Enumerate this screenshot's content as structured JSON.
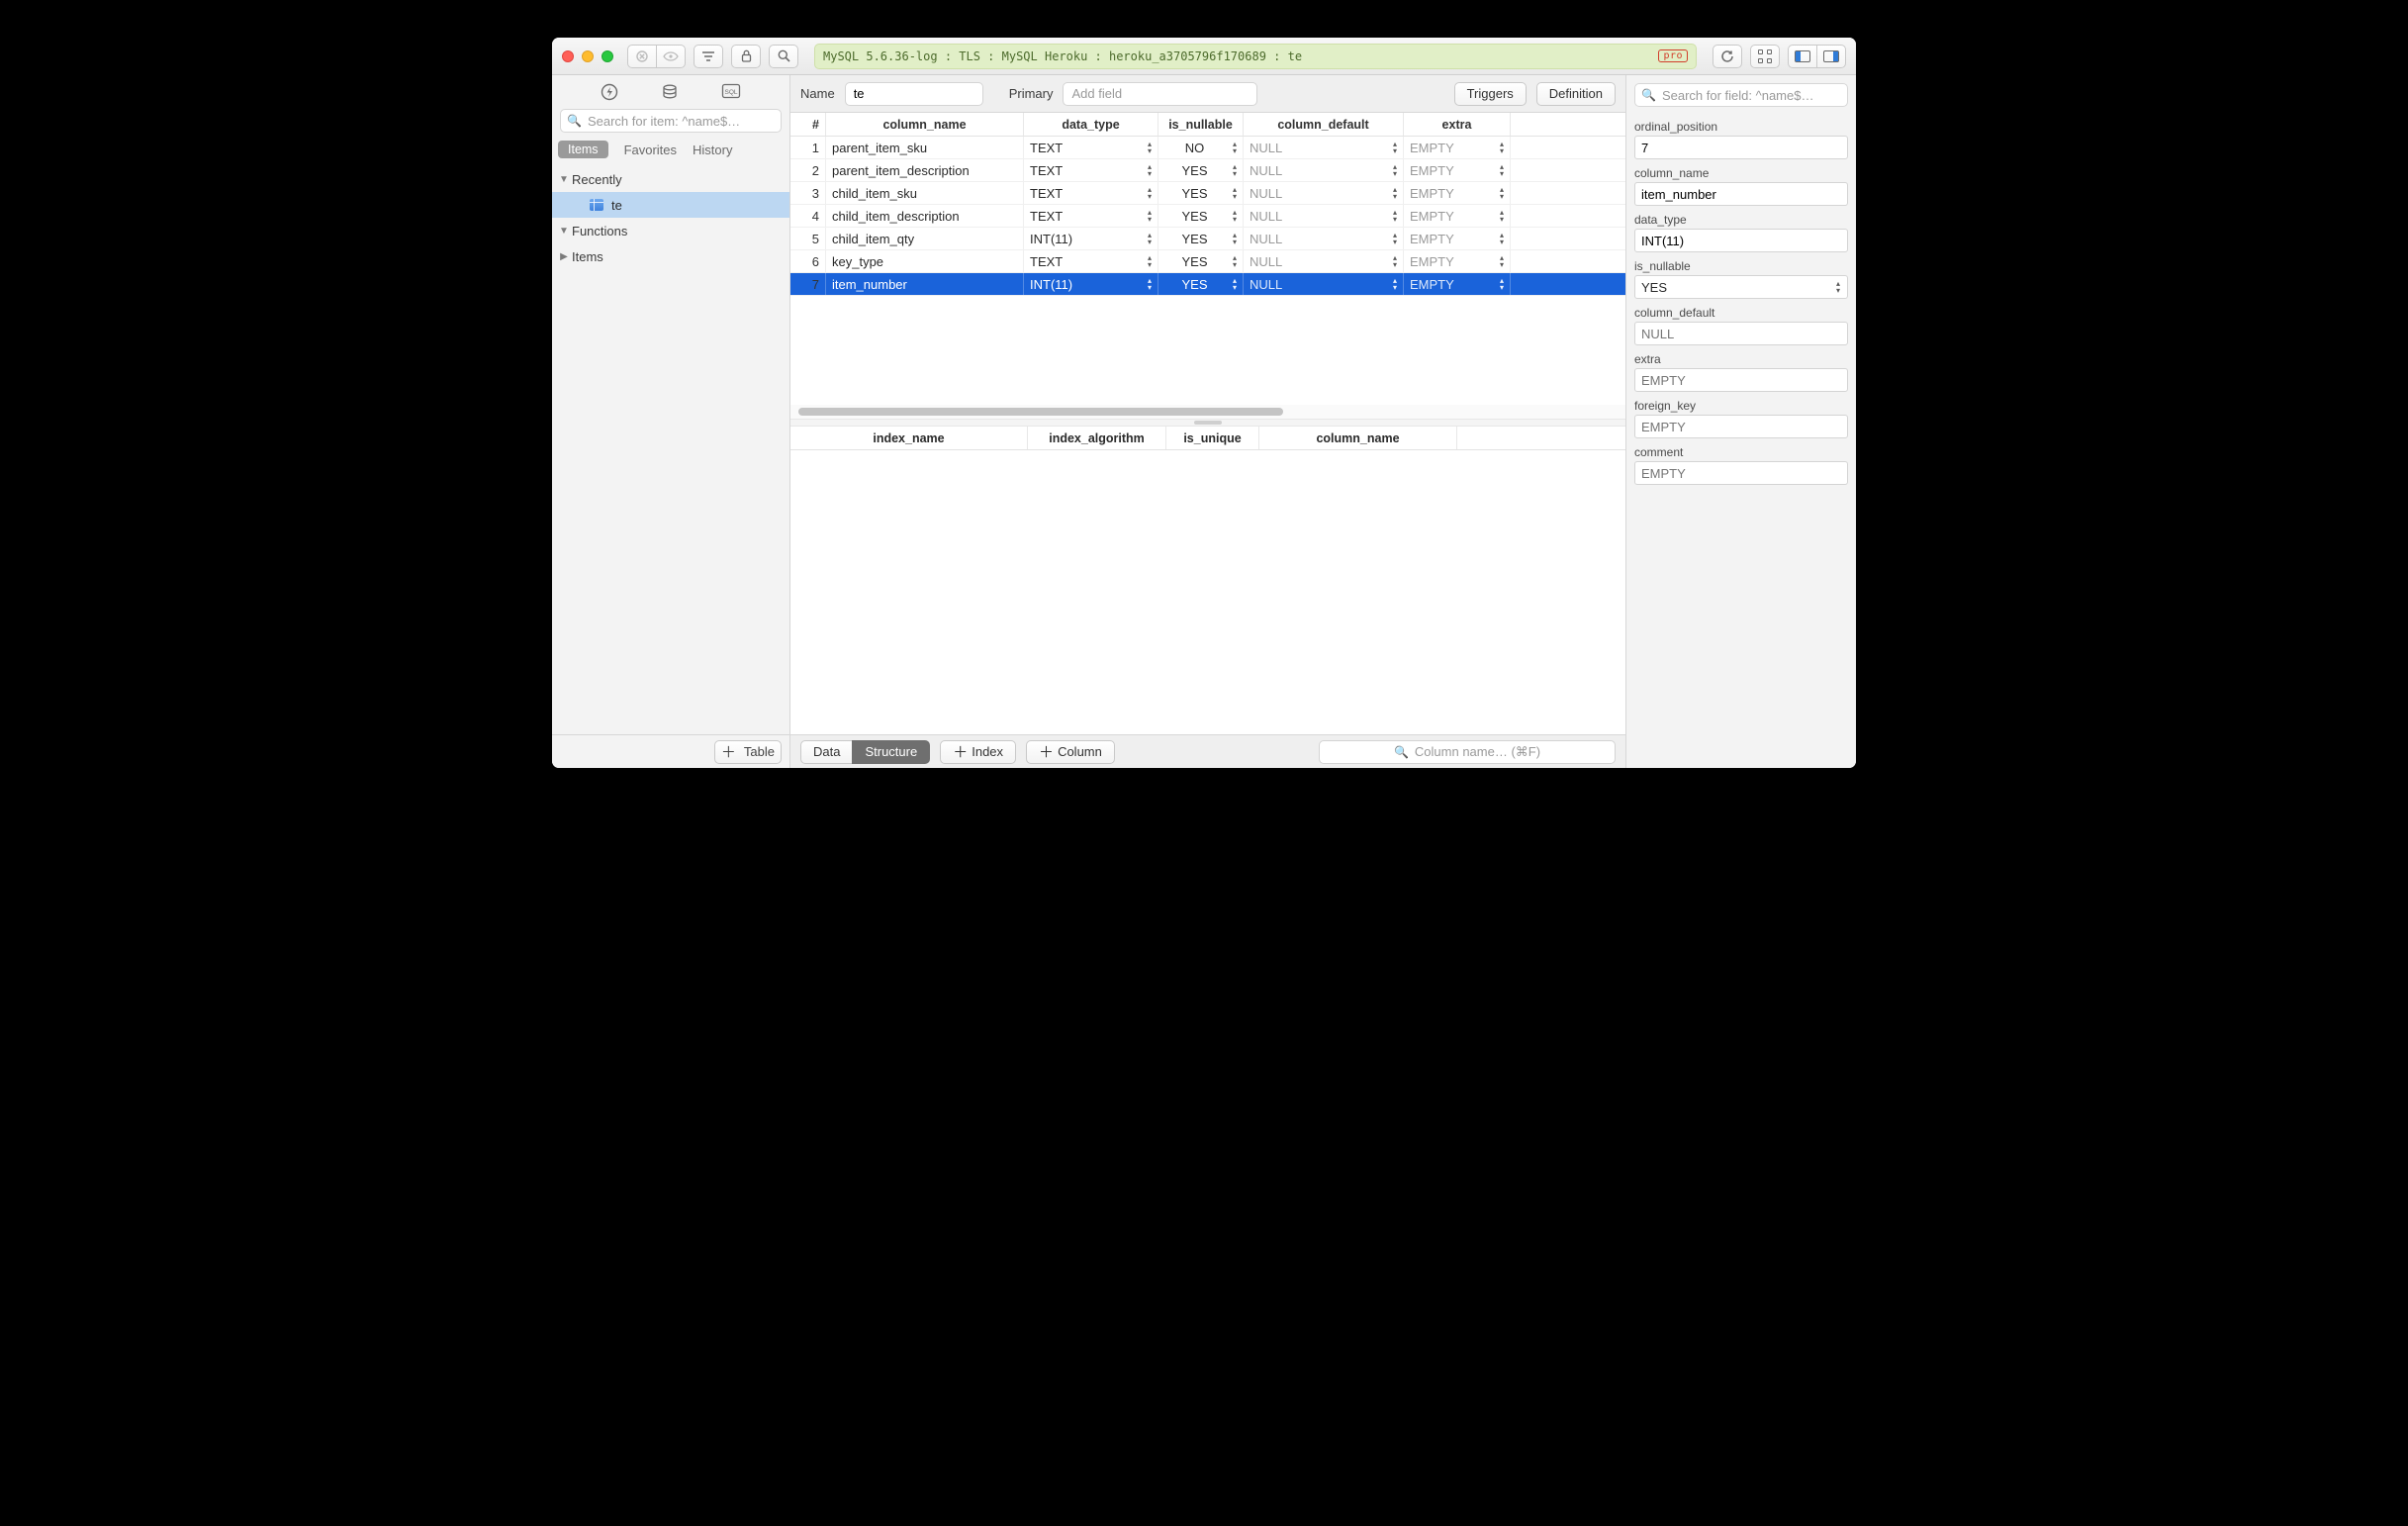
{
  "titlebar": {
    "connection": "MySQL 5.6.36-log : TLS : MySQL Heroku : heroku_a3705796f170689 : te",
    "pro_badge": "pro"
  },
  "sidebar": {
    "search_placeholder": "Search for item: ^name$…",
    "tabs": {
      "items": "Items",
      "favorites": "Favorites",
      "history": "History"
    },
    "tree": {
      "recently": "Recently",
      "selected_item": "te",
      "functions": "Functions",
      "items": "Items"
    },
    "add_table": "Table"
  },
  "main_head": {
    "name_label": "Name",
    "name_value": "te",
    "primary": "Primary",
    "add_field_placeholder": "Add field",
    "triggers": "Triggers",
    "definition": "Definition"
  },
  "columns": {
    "headers": {
      "idx": "#",
      "name": "column_name",
      "type": "data_type",
      "nullable": "is_nullable",
      "def": "column_default",
      "extra": "extra"
    },
    "rows": [
      {
        "i": "1",
        "name": "parent_item_sku",
        "type": "TEXT",
        "null": "NO",
        "def": "NULL",
        "extra": "EMPTY"
      },
      {
        "i": "2",
        "name": "parent_item_description",
        "type": "TEXT",
        "null": "YES",
        "def": "NULL",
        "extra": "EMPTY"
      },
      {
        "i": "3",
        "name": "child_item_sku",
        "type": "TEXT",
        "null": "YES",
        "def": "NULL",
        "extra": "EMPTY"
      },
      {
        "i": "4",
        "name": "child_item_description",
        "type": "TEXT",
        "null": "YES",
        "def": "NULL",
        "extra": "EMPTY"
      },
      {
        "i": "5",
        "name": "child_item_qty",
        "type": "INT(11)",
        "null": "YES",
        "def": "NULL",
        "extra": "EMPTY"
      },
      {
        "i": "6",
        "name": "key_type",
        "type": "TEXT",
        "null": "YES",
        "def": "NULL",
        "extra": "EMPTY"
      },
      {
        "i": "7",
        "name": "item_number",
        "type": "INT(11)",
        "null": "YES",
        "def": "NULL",
        "extra": "EMPTY"
      }
    ],
    "selected_index": 6
  },
  "indexes": {
    "headers": {
      "name": "index_name",
      "alg": "index_algorithm",
      "uni": "is_unique",
      "col": "column_name"
    }
  },
  "main_foot": {
    "data": "Data",
    "structure": "Structure",
    "add_index": "Index",
    "add_column": "Column",
    "search_placeholder": "Column name… (⌘F)"
  },
  "inspector": {
    "search_placeholder": "Search for field: ^name$…",
    "fields": {
      "ordinal_position": {
        "label": "ordinal_position",
        "value": "7"
      },
      "column_name": {
        "label": "column_name",
        "value": "item_number"
      },
      "data_type": {
        "label": "data_type",
        "value": "INT(11)"
      },
      "is_nullable": {
        "label": "is_nullable",
        "value": "YES"
      },
      "column_default": {
        "label": "column_default",
        "placeholder": "NULL"
      },
      "extra": {
        "label": "extra",
        "placeholder": "EMPTY"
      },
      "foreign_key": {
        "label": "foreign_key",
        "placeholder": "EMPTY"
      },
      "comment": {
        "label": "comment",
        "placeholder": "EMPTY"
      }
    }
  }
}
